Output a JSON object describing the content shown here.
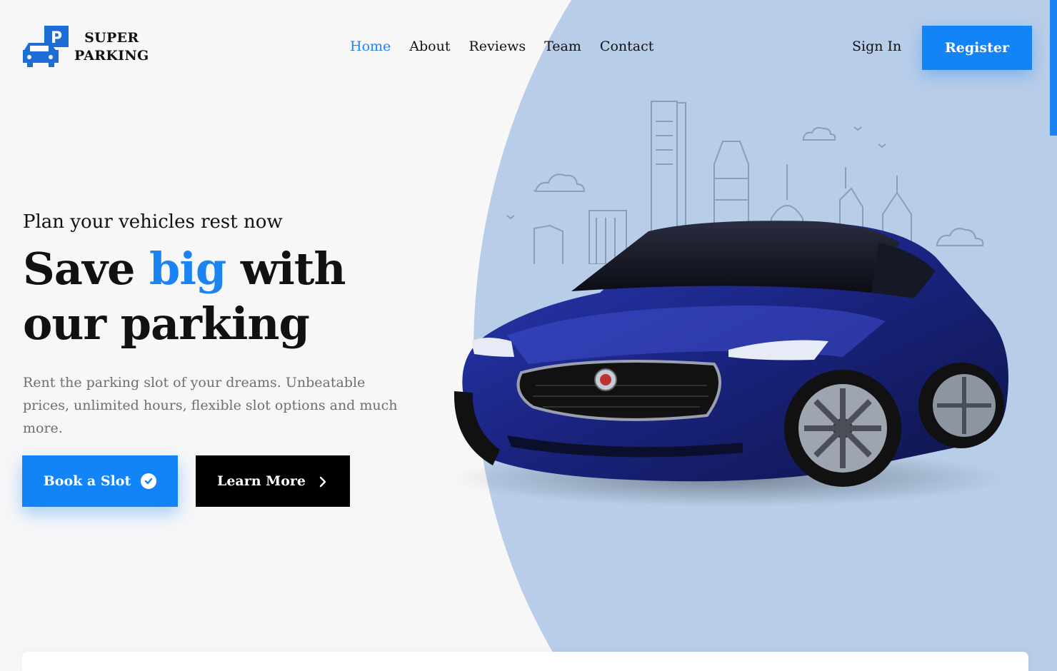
{
  "brand": {
    "line1": "SUPER",
    "line2": "PARKING",
    "logo_letter": "P"
  },
  "nav": {
    "items": [
      {
        "label": "Home",
        "active": true
      },
      {
        "label": "About",
        "active": false
      },
      {
        "label": "Reviews",
        "active": false
      },
      {
        "label": "Team",
        "active": false
      },
      {
        "label": "Contact",
        "active": false
      }
    ],
    "signin_label": "Sign In",
    "register_label": "Register"
  },
  "hero": {
    "tagline": "Plan your vehicles rest now",
    "headline_part1": "Save ",
    "headline_highlight": "big",
    "headline_part2": " with our parking",
    "description": "Rent the parking slot of your dreams. Unbeatable prices, unlimited hours, flexible slot options and much more.",
    "primary_cta": "Book a Slot",
    "secondary_cta": "Learn More"
  },
  "icons": {
    "logo": "parking-car-icon",
    "primary_cta": "check-circle-icon",
    "secondary_cta": "chevron-right-icon"
  },
  "colors": {
    "accent": "#1284f7",
    "highlight_text": "#1b84f2",
    "hero_shape": "#b8cde8",
    "dark_button": "#000000",
    "background": "#f7f7f8",
    "car_body": "#1e2a8a"
  }
}
